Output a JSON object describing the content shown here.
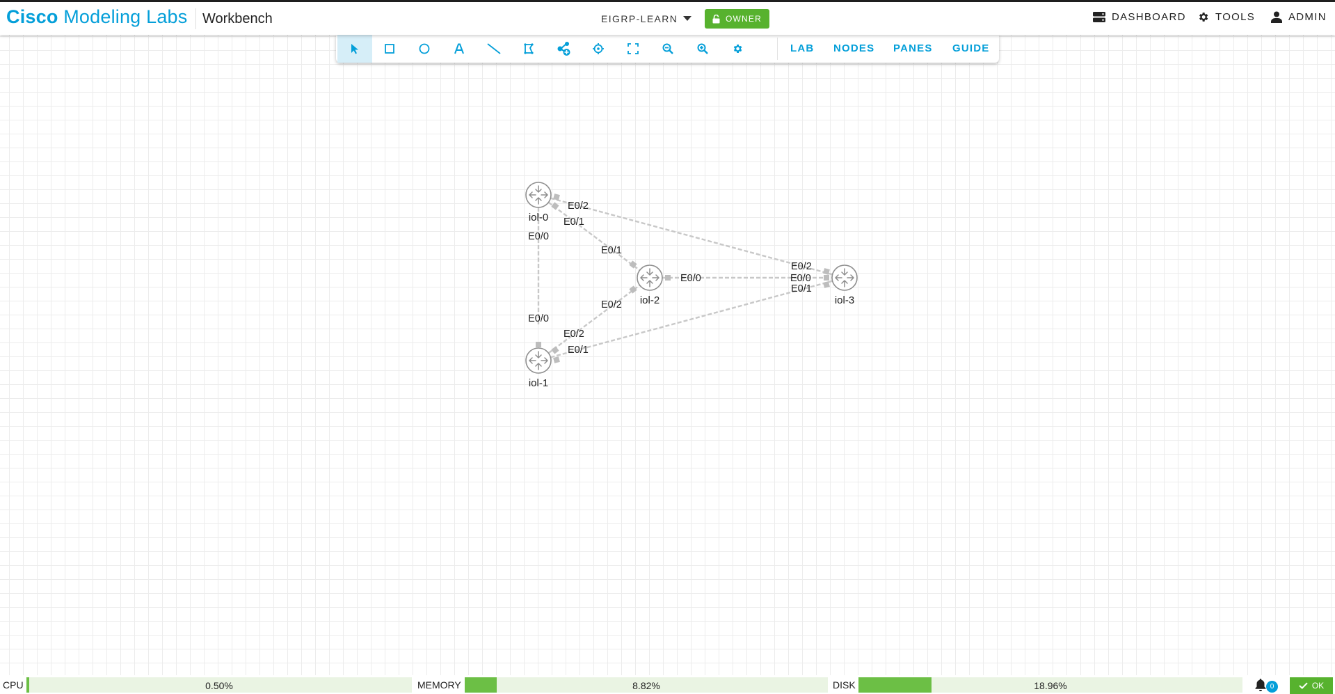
{
  "header": {
    "brand_bold": "Cisco",
    "brand_rest": " Modeling Labs",
    "section": "Workbench",
    "lab_name": "EIGRP-LEARN",
    "owner_badge": "OWNER",
    "nav": [
      "DASHBOARD",
      "TOOLS",
      "ADMIN"
    ]
  },
  "toolbar": {
    "tools": [
      "select-tool",
      "rectangle-tool",
      "ellipse-tool",
      "text-tool",
      "line-tool",
      "freeform-tool",
      "add-node-tool",
      "center-tool",
      "fit-to-screen-tool",
      "zoom-out-tool",
      "zoom-in-tool",
      "settings-tool"
    ],
    "active_tool": "select-tool",
    "links": [
      "LAB",
      "NODES",
      "PANES",
      "GUIDE"
    ]
  },
  "topology": {
    "nodes": [
      {
        "id": "iol-0",
        "label": "iol-0"
      },
      {
        "id": "iol-1",
        "label": "iol-1"
      },
      {
        "id": "iol-2",
        "label": "iol-2"
      },
      {
        "id": "iol-3",
        "label": "iol-3"
      }
    ],
    "links": [
      {
        "a": "iol-0",
        "a_if": "E0/0",
        "b": "iol-1",
        "b_if": "E0/0"
      },
      {
        "a": "iol-0",
        "a_if": "E0/1",
        "b": "iol-2",
        "b_if": "E0/1"
      },
      {
        "a": "iol-0",
        "a_if": "E0/2",
        "b": "iol-3",
        "b_if": "E0/2"
      },
      {
        "a": "iol-1",
        "a_if": "E0/2",
        "b": "iol-2",
        "b_if": "E0/2"
      },
      {
        "a": "iol-1",
        "a_if": "E0/1",
        "b": "iol-3",
        "b_if": "E0/1"
      },
      {
        "a": "iol-2",
        "a_if": "E0/0",
        "b": "iol-3",
        "b_if": "E0/0"
      }
    ],
    "link_color": "#c8c8c8",
    "node_icon": "router-icon"
  },
  "status": {
    "cpu_label": "CPU",
    "cpu_value": "0.50%",
    "cpu_fraction": 0.005,
    "memory_label": "MEMORY",
    "memory_value": "8.82%",
    "memory_fraction": 0.0882,
    "disk_label": "DISK",
    "disk_value": "18.96%",
    "disk_fraction": 0.1896,
    "notifications": "0",
    "ok_label": "OK"
  },
  "colors": {
    "brand": "#049fd9",
    "accent_green": "#57b22e",
    "meter_fill": "#6cbf45",
    "meter_bg": "#eaf4e3",
    "active_tool_bg": "#d6eef8"
  }
}
